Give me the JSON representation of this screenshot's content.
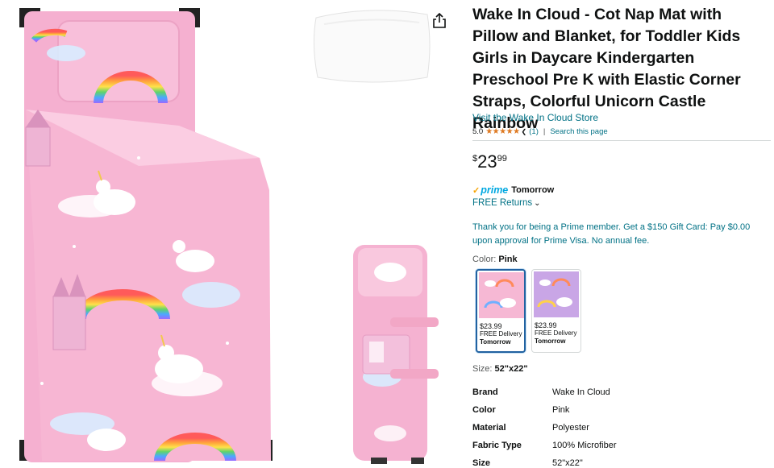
{
  "product": {
    "title": "Wake In Cloud - Cot Nap Mat with Pillow and Blanket, for Toddler Kids Girls in Daycare Kindergarten Preschool Pre K with Elastic Corner Straps, Colorful Unicorn Castle Rainbow",
    "store_link": "Visit the Wake In Cloud Store",
    "rating": "5.0",
    "stars": "★★★★★",
    "review_count": "(1)",
    "separator": "|",
    "search_page": "Search this page"
  },
  "price": {
    "symbol": "$",
    "whole": "23",
    "fraction": "99"
  },
  "delivery": {
    "prime_check": "✓",
    "prime_label": "prime",
    "day": "Tomorrow",
    "returns": "FREE Returns"
  },
  "promo": {
    "text": "Thank you for being a Prime member. Get a $150 Gift Card: Pay $0.00 upon approval for Prime Visa. No annual fee."
  },
  "color": {
    "label": "Color: ",
    "selected": "Pink",
    "options": [
      {
        "price": "$23.99",
        "delivery": "FREE Delivery",
        "day": "Tomorrow",
        "swatch_color": "#f6b8d4"
      },
      {
        "price": "$23.99",
        "delivery": "FREE Delivery",
        "day": "Tomorrow",
        "swatch_color": "#c9a6e6"
      }
    ]
  },
  "size": {
    "label": "Size: ",
    "selected": "52\"x22\""
  },
  "specs": [
    {
      "key": "Brand",
      "value": "Wake In Cloud"
    },
    {
      "key": "Color",
      "value": "Pink"
    },
    {
      "key": "Material",
      "value": "Polyester"
    },
    {
      "key": "Fabric Type",
      "value": "100% Microfiber"
    },
    {
      "key": "Size",
      "value": "52\"x22\""
    }
  ],
  "colors": {
    "link": "#007185",
    "text": "#0f1111",
    "star": "#de7921",
    "prime": "#00a8e1",
    "selected_border": "#2162a1",
    "mat_pink": "#f6b8d4"
  },
  "icons": {
    "share": "share-icon",
    "chevron": "chevron-down-icon",
    "star": "star-icon"
  }
}
